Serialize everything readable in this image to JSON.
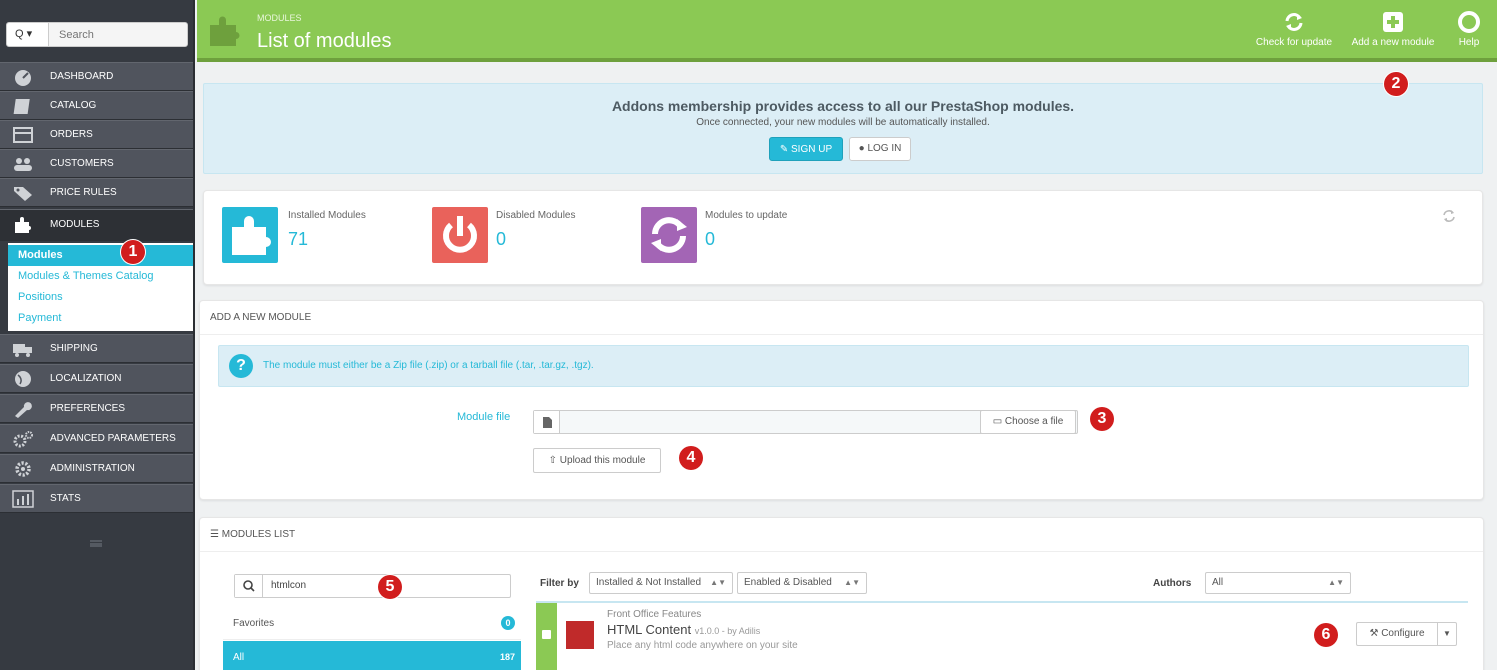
{
  "colors": {
    "accent": "#25b9d7",
    "header_green": "#8bc954",
    "callout_red": "#d11d1d"
  },
  "sidebar": {
    "search_button": "Q ▾",
    "search_placeholder": "Search",
    "items": [
      {
        "label": "DASHBOARD",
        "icon": "dashboard-icon"
      },
      {
        "label": "CATALOG",
        "icon": "catalog-icon"
      },
      {
        "label": "ORDERS",
        "icon": "orders-icon"
      },
      {
        "label": "CUSTOMERS",
        "icon": "customers-icon"
      },
      {
        "label": "PRICE RULES",
        "icon": "price-tag-icon"
      },
      {
        "label": "MODULES",
        "icon": "puzzle-icon"
      },
      {
        "label": "SHIPPING",
        "icon": "truck-icon"
      },
      {
        "label": "LOCALIZATION",
        "icon": "globe-icon"
      },
      {
        "label": "PREFERENCES",
        "icon": "wrench-icon"
      },
      {
        "label": "ADVANCED PARAMETERS",
        "icon": "gears-icon"
      },
      {
        "label": "ADMINISTRATION",
        "icon": "gear-icon"
      },
      {
        "label": "STATS",
        "icon": "bar-chart-icon"
      }
    ],
    "submenu": [
      "Modules",
      "Modules & Themes Catalog",
      "Positions",
      "Payment"
    ]
  },
  "header": {
    "breadcrumb": "MODULES",
    "title": "List of modules",
    "toolbar": [
      "Check for update",
      "Add a new module",
      "Help"
    ]
  },
  "addons": {
    "headline": "Addons membership provides access to all our PrestaShop modules.",
    "subline": "Once connected, your new modules will be automatically installed.",
    "signup": "SIGN UP",
    "login": "LOG IN"
  },
  "kpis": [
    {
      "label": "Installed Modules",
      "value": "71"
    },
    {
      "label": "Disabled Modules",
      "value": "0"
    },
    {
      "label": "Modules to update",
      "value": "0"
    }
  ],
  "add_module": {
    "title": "ADD A NEW MODULE",
    "info": "The module must either be a Zip file (.zip) or a tarball file (.tar, .tar.gz, .tgz).",
    "file_label": "Module file",
    "choose": "Choose a file",
    "upload": "Upload this module"
  },
  "modules_list": {
    "title": "MODULES LIST",
    "search_value": "htmlcon",
    "categories": [
      {
        "label": "Favorites",
        "count": "0"
      },
      {
        "label": "All",
        "count": "187"
      }
    ],
    "filter_by": "Filter by",
    "filter_install": "Installed & Not Installed",
    "filter_enabled": "Enabled & Disabled",
    "authors_label": "Authors",
    "authors_value": "All",
    "module": {
      "category": "Front Office Features",
      "name": "HTML Content",
      "version": "v1.0.0 - by Adilis",
      "description": "Place any html code anywhere on your site",
      "configure": "Configure"
    }
  },
  "callouts": [
    "1",
    "2",
    "3",
    "4",
    "5",
    "6"
  ]
}
